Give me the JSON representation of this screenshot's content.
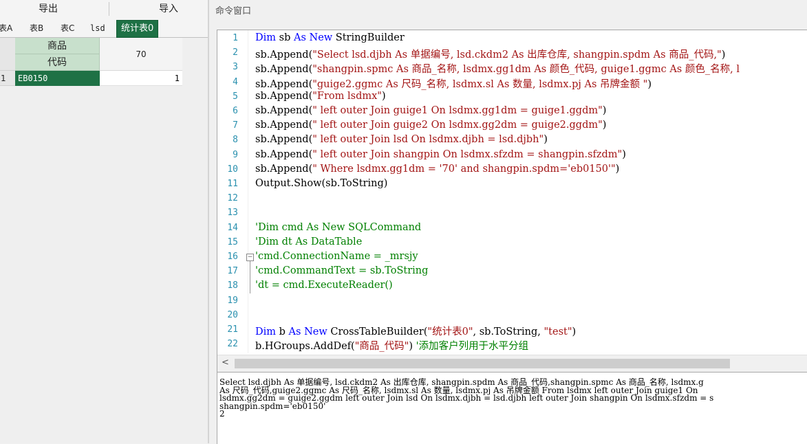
{
  "left": {
    "export_label": "导出",
    "import_label": "导入",
    "tabs": [
      "表A",
      "表B",
      "表C",
      "lsd",
      "统计表0"
    ],
    "grid": {
      "header_top": "商品",
      "header_sub": "代码",
      "header_value": "70",
      "row_number": "1",
      "row_code": "EB0150",
      "row_value": "1"
    }
  },
  "right": {
    "title": "命令窗口",
    "line_numbers": [
      "1",
      "2",
      "3",
      "4",
      "5",
      "6",
      "7",
      "8",
      "9",
      "10",
      "11",
      "12",
      "13",
      "14",
      "15",
      "16",
      "17",
      "18",
      "19",
      "20",
      "21",
      "22"
    ],
    "code": [
      "Dim sb As New StringBuilder",
      "sb.Append(\"Select lsd.djbh As 单据编号, lsd.ckdm2 As 出库仓库, shangpin.spdm As 商品_代码,\")",
      "sb.Append(\"shangpin.spmc As 商品_名称, lsdmx.gg1dm As 颜色_代码, guige1.ggmc As 颜色_名称, l",
      "sb.Append(\"guige2.ggmc As 尺码_名称, lsdmx.sl As 数量, lsdmx.pj As 吊牌金额 \")",
      "sb.Append(\"From lsdmx\")",
      "sb.Append(\" left outer Join guige1 On lsdmx.gg1dm = guige1.ggdm\")",
      "sb.Append(\" left outer Join guige2 On lsdmx.gg2dm = guige2.ggdm\")",
      "sb.Append(\" left outer Join lsd On lsdmx.djbh = lsd.djbh\")",
      "sb.Append(\" left outer Join shangpin On lsdmx.sfzdm = shangpin.sfzdm\")",
      "sb.Append(\" Where lsdmx.gg1dm = '70' and shangpin.spdm='eb0150'\")",
      "Output.Show(sb.ToString)",
      "",
      "",
      "'Dim cmd As New SQLCommand",
      "'Dim dt As DataTable",
      "'cmd.ConnectionName = _mrsjy",
      "'cmd.CommandText = sb.ToString",
      "'dt = cmd.ExecuteReader()",
      "",
      "",
      "Dim b As New CrossTableBuilder(\"统计表0\", sb.ToString, \"test\")",
      "b.HGroups.AddDef(\"商品_代码\") '添加客户列用于水平分组"
    ],
    "output_lines": [
      "Select lsd.djbh As 单据编号, lsd.ckdm2 As 出库仓库, shangpin.spdm As 商品_代码,shangpin.spmc As 商品_名称, lsdmx.g",
      "As 尺码_代码,guige2.ggmc As 尺码_名称, lsdmx.sl As 数量, lsdmx.pj As 吊牌金额 From lsdmx left outer Join guige1 On",
      "lsdmx.gg2dm = guige2.ggdm left outer Join lsd On lsdmx.djbh = lsd.djbh left outer Join shangpin On lsdmx.sfzdm = s",
      "shangpin.spdm='eb0150'",
      "2"
    ]
  }
}
